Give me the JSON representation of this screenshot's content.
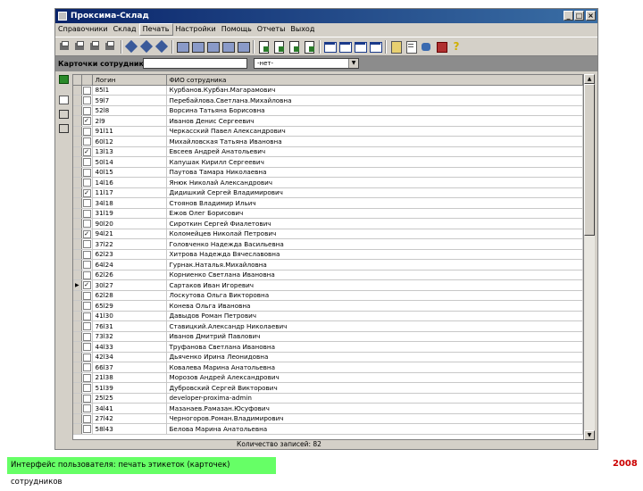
{
  "window": {
    "title": "Проксима-Склад"
  },
  "menu": [
    "Справочники",
    "Склад",
    "Печать",
    "Настройки",
    "Помощь",
    "Отчеты",
    "Выход"
  ],
  "filter": {
    "label": "Карточки сотрудников",
    "input_value": "",
    "select_value": "-нет-"
  },
  "table": {
    "columns": [
      "Логин",
      "ФИО сотрудника"
    ],
    "rows": [
      {
        "login": "85l1",
        "name": "Курбанов.Курбан.Магарамович",
        "checked": false
      },
      {
        "login": "59l7",
        "name": "Перебайлова.Светлана.Михайловна",
        "checked": false
      },
      {
        "login": "52l8",
        "name": "Ворсина Татьяна Борисовна",
        "checked": false
      },
      {
        "login": "2l9",
        "name": "Иванов Денис Сергеевич",
        "checked": true
      },
      {
        "login": "91l11",
        "name": "Черкасский Павел Александрович",
        "checked": false
      },
      {
        "login": "60l12",
        "name": "Михайловская Татьяна Ивановна",
        "checked": false
      },
      {
        "login": "13l13",
        "name": "Евсеев Андрей Анатольевич",
        "checked": true
      },
      {
        "login": "50l14",
        "name": "Капушак Кирилл Сергеевич",
        "checked": false
      },
      {
        "login": "40l15",
        "name": "Паутова Тамара Николаевна",
        "checked": false
      },
      {
        "login": "14l16",
        "name": "Янюк Николай Александрович",
        "checked": false
      },
      {
        "login": "11l17",
        "name": "Дидишкий Сергей Владимирович",
        "checked": true
      },
      {
        "login": "34l18",
        "name": "Стоянов Владимир Ильич",
        "checked": false
      },
      {
        "login": "31l19",
        "name": "Ежов Олег Борисович",
        "checked": false
      },
      {
        "login": "90l20",
        "name": "Сироткин Сергей Фиалетович",
        "checked": false
      },
      {
        "login": "94l21",
        "name": "Коломейцев Николай Петрович",
        "checked": true
      },
      {
        "login": "37l22",
        "name": "Головченко Надежда Васильевна",
        "checked": false
      },
      {
        "login": "62l23",
        "name": "Хитрова Надежда Вячеславовна",
        "checked": false
      },
      {
        "login": "64l24",
        "name": "Гурнак.Наталья.Михайловна",
        "checked": false
      },
      {
        "login": "62l26",
        "name": "Корниенко Светлана Ивановна",
        "checked": false
      },
      {
        "login": "30l27",
        "name": "Сартаков Иван Игоревич",
        "checked": true,
        "current": true
      },
      {
        "login": "62l28",
        "name": "Лоскутова Ольга Викторовна",
        "checked": false
      },
      {
        "login": "65l29",
        "name": "Конева Ольга Ивановна",
        "checked": false
      },
      {
        "login": "41l30",
        "name": "Давыдов Роман Петрович",
        "checked": false
      },
      {
        "login": "76l31",
        "name": "Ставицкий.Александр Николаевич",
        "checked": false
      },
      {
        "login": "73l32",
        "name": "Иванов Дмитрий Павлович",
        "checked": false
      },
      {
        "login": "44l33",
        "name": "Труфанова Светлана Ивановна",
        "checked": false
      },
      {
        "login": "42l34",
        "name": "Дьяченко Ирина Леонидовна",
        "checked": false
      },
      {
        "login": "66l37",
        "name": "Ковалева Марина Анатольевна",
        "checked": false
      },
      {
        "login": "21l38",
        "name": "Морозов Андрей Александрович",
        "checked": false
      },
      {
        "login": "51l39",
        "name": "Дубровский Сергей Викторович",
        "checked": false
      },
      {
        "login": "25l25",
        "name": "developer-proxima-admin",
        "checked": false
      },
      {
        "login": "34l41",
        "name": "Мазанаев.Рамазан.Юсуфович",
        "checked": false
      },
      {
        "login": "27l42",
        "name": "Черногоров.Роман.Владимирович",
        "checked": false
      },
      {
        "login": "58l43",
        "name": "Белова Марина Анатольевна",
        "checked": false
      }
    ]
  },
  "status": {
    "count_text": "Количество записей: 82"
  },
  "caption": "Интерфейс пользователя: печать этикеток (карточек) сотрудников",
  "year": "2008",
  "colors": {
    "title_bar": "#0a246a",
    "caption_bg": "#66ff66",
    "year": "#cc0000"
  },
  "icons": [
    "app-icon",
    "minimize-icon",
    "maximize-icon",
    "close-icon",
    "excel-icon",
    "label-icon",
    "copy-icon",
    "paste-icon",
    "help-icon",
    "row-pointer-icon",
    "checkmark-icon"
  ]
}
